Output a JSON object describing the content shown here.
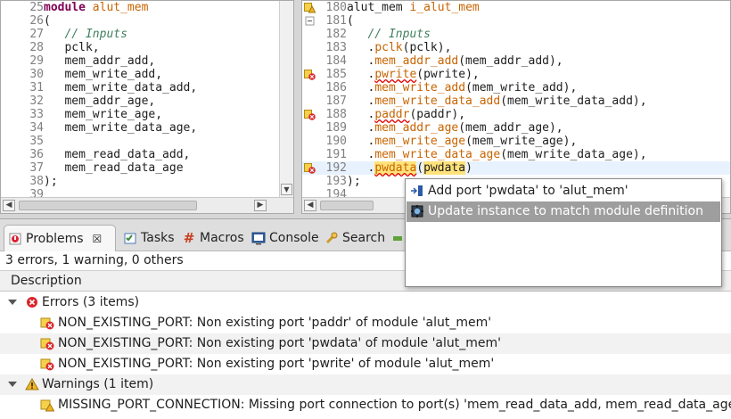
{
  "left_editor": {
    "lines": [
      {
        "num": "25",
        "marker": "",
        "tokens": [
          {
            "t": "module ",
            "c": "kw"
          },
          {
            "t": "alut_mem",
            "c": "ident"
          }
        ]
      },
      {
        "num": "26",
        "marker": "",
        "tokens": [
          {
            "t": "(",
            "c": ""
          }
        ]
      },
      {
        "num": "27",
        "marker": "",
        "tokens": [
          {
            "t": "   // Inputs",
            "c": "cmt"
          }
        ]
      },
      {
        "num": "28",
        "marker": "",
        "tokens": [
          {
            "t": "   pclk,",
            "c": ""
          }
        ]
      },
      {
        "num": "29",
        "marker": "",
        "tokens": [
          {
            "t": "   mem_addr_add,",
            "c": ""
          }
        ]
      },
      {
        "num": "30",
        "marker": "",
        "tokens": [
          {
            "t": "   mem_write_add,",
            "c": ""
          }
        ]
      },
      {
        "num": "31",
        "marker": "",
        "tokens": [
          {
            "t": "   mem_write_data_add,",
            "c": ""
          }
        ]
      },
      {
        "num": "32",
        "marker": "",
        "tokens": [
          {
            "t": "   mem_addr_age,",
            "c": ""
          }
        ]
      },
      {
        "num": "33",
        "marker": "",
        "tokens": [
          {
            "t": "   mem_write_age,",
            "c": ""
          }
        ]
      },
      {
        "num": "34",
        "marker": "",
        "tokens": [
          {
            "t": "   mem_write_data_age,",
            "c": ""
          }
        ]
      },
      {
        "num": "35",
        "marker": "",
        "tokens": [
          {
            "t": "",
            "c": ""
          }
        ]
      },
      {
        "num": "36",
        "marker": "",
        "tokens": [
          {
            "t": "   mem_read_data_add,",
            "c": ""
          }
        ]
      },
      {
        "num": "37",
        "marker": "",
        "tokens": [
          {
            "t": "   mem_read_data_age",
            "c": ""
          }
        ]
      },
      {
        "num": "38",
        "marker": "",
        "tokens": [
          {
            "t": ");",
            "c": ""
          }
        ]
      },
      {
        "num": "39",
        "marker": "",
        "tokens": [
          {
            "t": "",
            "c": ""
          }
        ]
      }
    ]
  },
  "right_editor": {
    "lines": [
      {
        "num": "180",
        "marker": "warning",
        "tokens": [
          {
            "t": "alut_mem ",
            "c": ""
          },
          {
            "t": "i_alut_mem",
            "c": "ident"
          }
        ]
      },
      {
        "num": "181",
        "marker": "fold",
        "tokens": [
          {
            "t": "(",
            "c": ""
          }
        ]
      },
      {
        "num": "182",
        "marker": "",
        "tokens": [
          {
            "t": "   // Inputs",
            "c": "cmt"
          }
        ]
      },
      {
        "num": "183",
        "marker": "",
        "tokens": [
          {
            "t": "   .",
            "c": ""
          },
          {
            "t": "pclk",
            "c": "port"
          },
          {
            "t": "(pclk),",
            "c": ""
          }
        ]
      },
      {
        "num": "184",
        "marker": "",
        "tokens": [
          {
            "t": "   .",
            "c": ""
          },
          {
            "t": "mem_addr_add",
            "c": "port"
          },
          {
            "t": "(mem_addr_add),",
            "c": ""
          }
        ]
      },
      {
        "num": "185",
        "marker": "error",
        "tokens": [
          {
            "t": "   .",
            "c": ""
          },
          {
            "t": "pwrite",
            "c": "port err"
          },
          {
            "t": "(pwrite),",
            "c": ""
          }
        ]
      },
      {
        "num": "186",
        "marker": "",
        "tokens": [
          {
            "t": "   .",
            "c": ""
          },
          {
            "t": "mem_write_add",
            "c": "port"
          },
          {
            "t": "(mem_write_add),",
            "c": ""
          }
        ]
      },
      {
        "num": "187",
        "marker": "",
        "tokens": [
          {
            "t": "   .",
            "c": ""
          },
          {
            "t": "mem_write_data_add",
            "c": "port"
          },
          {
            "t": "(mem_write_data_add),",
            "c": ""
          }
        ]
      },
      {
        "num": "188",
        "marker": "error",
        "tokens": [
          {
            "t": "   .",
            "c": ""
          },
          {
            "t": "paddr",
            "c": "port err"
          },
          {
            "t": "(paddr),",
            "c": ""
          }
        ]
      },
      {
        "num": "189",
        "marker": "",
        "tokens": [
          {
            "t": "   .",
            "c": ""
          },
          {
            "t": "mem_addr_age",
            "c": "port"
          },
          {
            "t": "(mem_addr_age),",
            "c": ""
          }
        ]
      },
      {
        "num": "190",
        "marker": "",
        "tokens": [
          {
            "t": "   .",
            "c": ""
          },
          {
            "t": "mem_write_age",
            "c": "port"
          },
          {
            "t": "(mem_write_age),",
            "c": ""
          }
        ]
      },
      {
        "num": "191",
        "marker": "",
        "tokens": [
          {
            "t": "   .",
            "c": ""
          },
          {
            "t": "mem_write_data_age",
            "c": "port"
          },
          {
            "t": "(mem_write_data_age),",
            "c": ""
          }
        ]
      },
      {
        "num": "192",
        "marker": "error",
        "highlight": true,
        "tokens": [
          {
            "t": "   .",
            "c": ""
          },
          {
            "t": "pwdata",
            "c": "port err hl-word"
          },
          {
            "t": "(",
            "c": ""
          },
          {
            "t": "pwdata",
            "c": "hl-word"
          },
          {
            "t": ")",
            "c": ""
          }
        ]
      },
      {
        "num": "193",
        "marker": "",
        "tokens": [
          {
            "t": ");",
            "c": ""
          }
        ]
      },
      {
        "num": "194",
        "marker": "",
        "tokens": [
          {
            "t": "",
            "c": ""
          }
        ]
      }
    ]
  },
  "tabs": [
    {
      "label": "Problems",
      "icon": "problems-icon",
      "active": true,
      "close": "☒"
    },
    {
      "label": "Tasks",
      "icon": "tasks-icon"
    },
    {
      "label": "Macros",
      "icon": "macros-icon"
    },
    {
      "label": "Console",
      "icon": "console-icon"
    },
    {
      "label": "Search",
      "icon": "search-icon"
    }
  ],
  "problems": {
    "summary": "3 errors, 1 warning, 0 others",
    "column_header": "Description",
    "errors_group": "Errors (3 items)",
    "errors": [
      "NON_EXISTING_PORT: Non existing port 'paddr' of module 'alut_mem'",
      "NON_EXISTING_PORT: Non existing port 'pwdata' of module 'alut_mem'",
      "NON_EXISTING_PORT: Non existing port 'pwrite' of module 'alut_mem'"
    ],
    "warnings_group": "Warnings (1 item)",
    "warnings": [
      "MISSING_PORT_CONNECTION: Missing port connection to port(s) 'mem_read_data_add, mem_read_data_age'"
    ]
  },
  "quick_fix": {
    "items": [
      {
        "label": "Add port 'pwdata' to 'alut_mem'",
        "icon": "add-port-icon",
        "selected": false
      },
      {
        "label": "Update instance to match module definition",
        "icon": "update-instance-icon",
        "selected": true
      }
    ]
  },
  "colors": {
    "keyword": "#7f0055",
    "identifier": "#c86400",
    "comment": "#3f7f5f",
    "error": "#e00000",
    "warning": "#e8a800",
    "selection": "#9e9e9e"
  }
}
